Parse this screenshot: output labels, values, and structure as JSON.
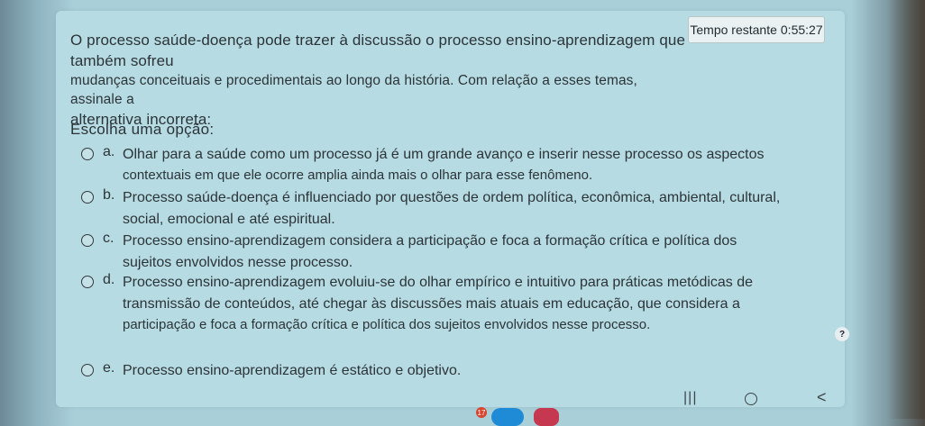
{
  "timer": {
    "label": "Tempo restante",
    "value": "0:55:27"
  },
  "question": {
    "line1": "O processo saúde-doença pode trazer à discussão o processo ensino-aprendizagem que também sofreu",
    "line2": "mudanças conceituais e procedimentais ao longo da história. Com relação a esses temas, assinale a",
    "line3": "alternativa incorreta:"
  },
  "choose_label": "Escolha uma opção:",
  "options": [
    {
      "letter": "a.",
      "lines": [
        "Olhar para a saúde como um processo já é um grande avanço e inserir nesse processo os aspectos",
        "contextuais em que ele ocorre amplia ainda mais o olhar para esse fenômeno."
      ]
    },
    {
      "letter": "b.",
      "lines": [
        "Processo saúde-doença é influenciado por questões de ordem política, econômica, ambiental, cultural,",
        "social, emocional e até espiritual."
      ]
    },
    {
      "letter": "c.",
      "lines": [
        "Processo ensino-aprendizagem considera a participação e foca a formação crítica e política dos",
        "sujeitos envolvidos nesse processo."
      ]
    },
    {
      "letter": "d.",
      "lines": [
        "Processo ensino-aprendizagem evoluiu-se do olhar empírico e intuitivo para práticas metódicas de",
        "transmissão de conteúdos, até chegar às discussões mais atuais em educação, que considera a",
        "participação e foca a formação crítica e política dos sujeitos envolvidos nesse processo."
      ]
    },
    {
      "letter": "e.",
      "lines": [
        "Processo ensino-aprendizagem é estático e objetivo."
      ]
    }
  ],
  "help": "?",
  "nav": {
    "recent": "|||",
    "back": "<"
  },
  "badge": "17"
}
